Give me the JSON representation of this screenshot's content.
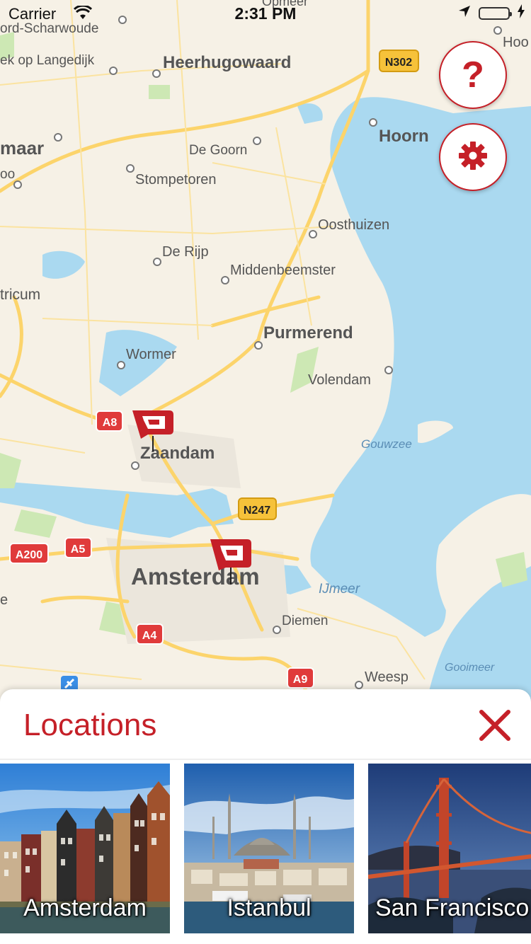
{
  "status": {
    "carrier": "Carrier",
    "time": "2:31 PM"
  },
  "map": {
    "places": {
      "opmeer": "Opmeer",
      "scharwoude": "ord-Scharwoude",
      "langedijk": "ek op Langedijk",
      "heerhugowaard": "Heerhugowaard",
      "hoo": "Hoo",
      "maar": "maar",
      "degoorn": "De Goorn",
      "hoorn": "Hoorn",
      "oo": "oo",
      "stompetoren": "Stompetoren",
      "oosthuizen": "Oosthuizen",
      "derijp": "De Rijp",
      "middenbeemster": "Middenbeemster",
      "tricum": "tricum",
      "purmerend": "Purmerend",
      "wormer": "Wormer",
      "volendam": "Volendam",
      "gouwzee": "Gouwzee",
      "zaandam": "Zaandam",
      "amsterdam": "Amsterdam",
      "ijmeer": "IJmeer",
      "diemen": "Diemen",
      "gooimeer": "Gooimeer",
      "weesp": "Weesp",
      "e": "e"
    },
    "roads": {
      "n302": "N302",
      "a8": "A8",
      "n247": "N247",
      "a200": "A200",
      "a5": "A5",
      "a4": "A4",
      "a9": "A9"
    },
    "colors": {
      "land": "#f6f1e6",
      "water": "#aad9f0",
      "road": "#fcd46b",
      "brand": "#c52028"
    }
  },
  "buttons": {
    "help_icon": "question-icon",
    "settings_icon": "gear-icon"
  },
  "sheet": {
    "title": "Locations",
    "close_icon": "close-icon",
    "locations": [
      {
        "label": "Amsterdam"
      },
      {
        "label": "Istanbul"
      },
      {
        "label": "San Francisco"
      }
    ]
  }
}
